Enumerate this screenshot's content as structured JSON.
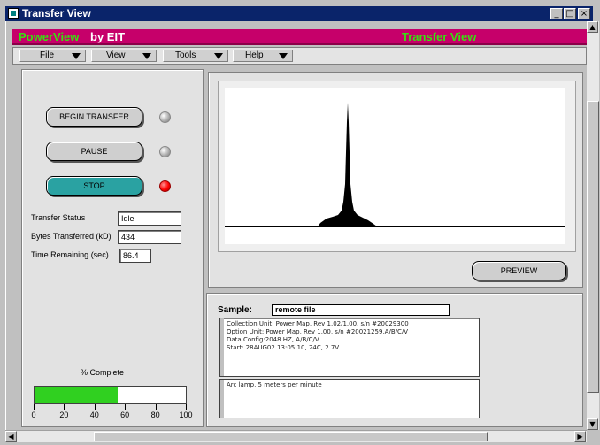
{
  "window": {
    "title": "Transfer View",
    "controls": {
      "minimize": "_",
      "maximize": "□",
      "close": "×"
    }
  },
  "header": {
    "brand_product": "PowerView",
    "brand_company": "by EIT",
    "view_title": "Transfer View",
    "colors": {
      "background": "#c6006a",
      "accent_green": "#38e010"
    }
  },
  "menubar": {
    "items": [
      {
        "label": "File"
      },
      {
        "label": "View"
      },
      {
        "label": "Tools"
      },
      {
        "label": "Help"
      }
    ]
  },
  "controls": {
    "begin_transfer": "BEGIN TRANSFER",
    "pause": "PAUSE",
    "stop": "STOP",
    "stop_color": "#2aa2a2",
    "active_led_color": "#ff0000"
  },
  "status": {
    "transfer_status_label": "Transfer Status",
    "transfer_status_value": "Idle",
    "bytes_label": "Bytes Transferred (kD)",
    "bytes_value": "434",
    "time_label": "Time Remaining (sec)",
    "time_value": "86.4"
  },
  "progress": {
    "label": "% Complete",
    "percent": 55,
    "ticks": [
      "0",
      "20",
      "40",
      "60",
      "80",
      "100"
    ],
    "fill_color": "#30d020"
  },
  "plot": {
    "preview_button": "PREVIEW"
  },
  "sample": {
    "label": "Sample:",
    "name": "remote file",
    "info_lines": [
      "Collection Unit: Power Map, Rev 1.02/1.00, s/n #20029300",
      "Option Unit: Power Map, Rev 1.00, s/n #20021259,A/B/C/V",
      "Data Config:2048 HZ, A/B/C/V",
      "Start:  28AUG02 13:05:10, 24C, 2.7V"
    ],
    "notes": "Arc lamp, 5 meters per minute"
  }
}
